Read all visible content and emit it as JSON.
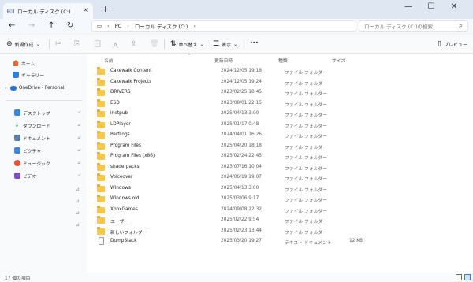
{
  "window": {
    "tab_title": "ローカル ディスク (C:)",
    "tab_close": "×",
    "new_tab": "+",
    "min": "—",
    "max": "☐",
    "close": "✕"
  },
  "nav": {
    "back": "←",
    "forward": "→",
    "up": "↑",
    "refresh": "↻",
    "pc_icon": "▭",
    "crumb_sep": "›",
    "crumbs": [
      "PC",
      "ローカル ディスク (C:)"
    ],
    "expand": "›"
  },
  "search": {
    "placeholder": "ローカル ディスク (C:)の検索",
    "icon": "⌕"
  },
  "toolbar": {
    "new_label": "新規作成",
    "new_icon": "⊕",
    "cut_icon": "✂",
    "copy_icon": "⎘",
    "paste_icon": "📋",
    "rename_icon": "Ａ",
    "share_icon": "⇪",
    "delete_icon": "🗑",
    "sort_label": "並べ替え",
    "sort_icon": "⇅",
    "view_label": "表示",
    "view_icon": "☰",
    "more": "•••",
    "preview_label": "プレビュー",
    "preview_icon": "▯",
    "chevron": "⌄"
  },
  "sidebar": {
    "items": [
      {
        "label": "ホーム",
        "icon": "home-icon",
        "color": "#e06c3c"
      },
      {
        "label": "ギャラリー",
        "icon": "gallery-icon",
        "color": "#2f7fd6"
      },
      {
        "label": "OneDrive - Personal",
        "icon": "cloud-icon",
        "color": "#1e74d8"
      },
      {
        "label": "デスクトップ",
        "icon": "desktop-icon",
        "color": "#3a88dd"
      },
      {
        "label": "ダウンロード",
        "icon": "download-icon",
        "color": "#2ea36a"
      },
      {
        "label": "ドキュメント",
        "icon": "document-icon",
        "color": "#5b7fa8"
      },
      {
        "label": "ピクチャ",
        "icon": "picture-icon",
        "color": "#3f86d9"
      },
      {
        "label": "ミュージック",
        "icon": "music-icon",
        "color": "#e2553a"
      },
      {
        "label": "ビデオ",
        "icon": "video-icon",
        "color": "#7d4fc4"
      }
    ],
    "pin_icon": "📌"
  },
  "columns": {
    "name": "名前",
    "date": "更新日時",
    "type": "種類",
    "size": "サイズ",
    "sort_arrow": "^"
  },
  "files": [
    {
      "name": "Cakewalk Content",
      "date": "2024/12/05 19:18",
      "type": "ファイル フォルダー",
      "size": "",
      "kind": "folder"
    },
    {
      "name": "Cakewalk Projects",
      "date": "2024/12/05 19:24",
      "type": "ファイル フォルダー",
      "size": "",
      "kind": "folder"
    },
    {
      "name": "DRIVERS",
      "date": "2023/02/25 18:45",
      "type": "ファイル フォルダー",
      "size": "",
      "kind": "folder"
    },
    {
      "name": "ESD",
      "date": "2023/08/01 22:15",
      "type": "ファイル フォルダー",
      "size": "",
      "kind": "folder"
    },
    {
      "name": "inetpub",
      "date": "2025/04/13 3:00",
      "type": "ファイル フォルダー",
      "size": "",
      "kind": "folder"
    },
    {
      "name": "LDPlayer",
      "date": "2025/01/17 0:48",
      "type": "ファイル フォルダー",
      "size": "",
      "kind": "folder"
    },
    {
      "name": "PerfLogs",
      "date": "2024/04/01 16:26",
      "type": "ファイル フォルダー",
      "size": "",
      "kind": "folder"
    },
    {
      "name": "Program Files",
      "date": "2025/04/20 18:18",
      "type": "ファイル フォルダー",
      "size": "",
      "kind": "folder"
    },
    {
      "name": "Program Files (x86)",
      "date": "2025/02/24 22:45",
      "type": "ファイル フォルダー",
      "size": "",
      "kind": "folder"
    },
    {
      "name": "shaderpacks",
      "date": "2023/07/16 10:04",
      "type": "ファイル フォルダー",
      "size": "",
      "kind": "folder"
    },
    {
      "name": "Voiceover",
      "date": "2024/06/19 19:07",
      "type": "ファイル フォルダー",
      "size": "",
      "kind": "folder"
    },
    {
      "name": "Windows",
      "date": "2025/04/13 3:00",
      "type": "ファイル フォルダー",
      "size": "",
      "kind": "folder"
    },
    {
      "name": "Windows.old",
      "date": "2025/03/06 9:17",
      "type": "ファイル フォルダー",
      "size": "",
      "kind": "folder"
    },
    {
      "name": "XboxGames",
      "date": "2024/09/08 22:32",
      "type": "ファイル フォルダー",
      "size": "",
      "kind": "folder"
    },
    {
      "name": "ユーザー",
      "date": "2025/02/22 9:54",
      "type": "ファイル フォルダー",
      "size": "",
      "kind": "folder"
    },
    {
      "name": "新しいフォルダー",
      "date": "2025/02/23 13:44",
      "type": "ファイル フォルダー",
      "size": "",
      "kind": "folder"
    },
    {
      "name": "DumpStack",
      "date": "2025/03/20 19:27",
      "type": "テキスト ドキュメント",
      "size": "12 KB",
      "kind": "file"
    }
  ],
  "status": {
    "item_count": "17 個の項目"
  }
}
